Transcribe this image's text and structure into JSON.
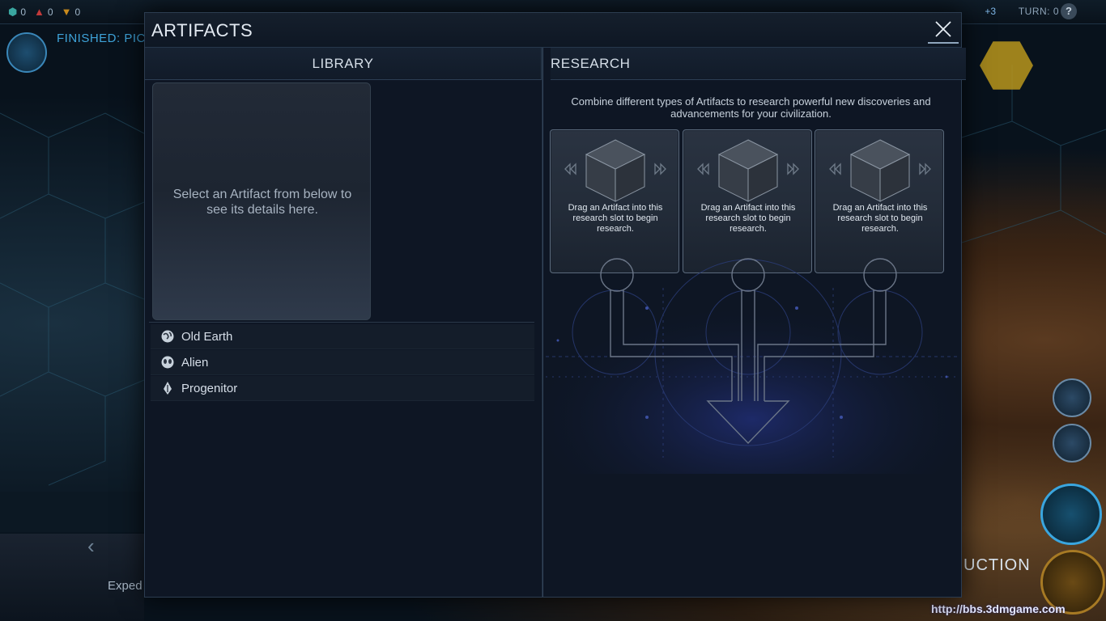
{
  "topbar": {
    "resources": [
      {
        "icon": "health-icon",
        "value": "0"
      },
      {
        "icon": "affinity-purity-icon",
        "value": "0"
      },
      {
        "icon": "affinity-supremacy-icon",
        "value": "0"
      }
    ],
    "research_rate": "+3",
    "turn_label": "TURN: 0",
    "help_label": "?"
  },
  "hud": {
    "finished_label": "FINISHED: PIC",
    "production_label": "UCTION",
    "expedition_label": "Exped"
  },
  "modal": {
    "title": "ARTIFACTS",
    "close_icon": "close-icon",
    "library": {
      "header": "LIBRARY",
      "detail_placeholder": "Select an Artifact from below to see its details here.",
      "categories": [
        {
          "label": "Old Earth",
          "icon": "globe-icon"
        },
        {
          "label": "Alien",
          "icon": "alien-icon"
        },
        {
          "label": "Progenitor",
          "icon": "progenitor-icon"
        }
      ]
    },
    "research": {
      "header": "RESEARCH",
      "description": "Combine different types of Artifacts to research powerful new discoveries and advancements for your civilization.",
      "slots": [
        {
          "text": "Drag an Artifact into this research slot to begin research."
        },
        {
          "text": "Drag an Artifact into this research slot to begin research."
        },
        {
          "text": "Drag an Artifact into this research slot to begin research."
        }
      ]
    }
  },
  "watermark": "http://bbs.3dmgame.com",
  "colors": {
    "accent_blue": "#3ea3d9",
    "panel_bg": "#0e1624",
    "slot_border": "#5b6a7c"
  }
}
